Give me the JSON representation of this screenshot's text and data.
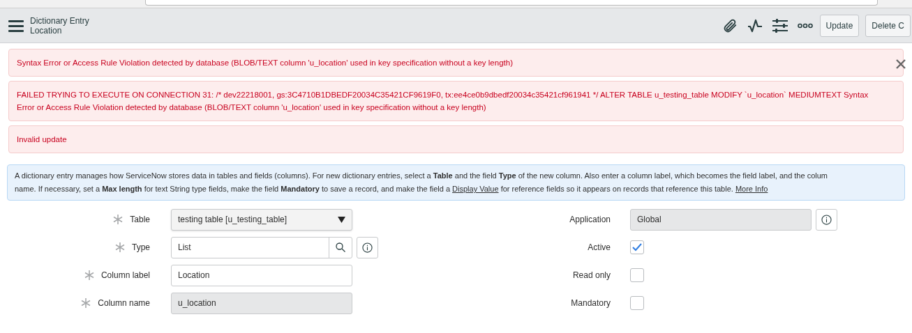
{
  "header": {
    "title": "Dictionary Entry",
    "subtitle": "Location",
    "buttons": [
      {
        "label": "Update"
      },
      {
        "label": "Delete C"
      }
    ]
  },
  "messages": [
    {
      "text": "Syntax Error or Access Rule Violation detected by database (BLOB/TEXT column 'u_location' used in key specification without a key length)",
      "closable": true
    },
    {
      "text": "FAILED TRYING TO EXECUTE ON CONNECTION 31: /* dev22218001, gs:3C4710B1DBEDF20034C35421CF9619F0, tx:ee4ce0b9dbedf20034c35421cf961941 */ ALTER TABLE u_testing_table MODIFY `u_location` MEDIUMTEXT Syntax Error or Access Rule Violation detected by database (BLOB/TEXT column 'u_location' used in key specification without a key length)",
      "closable": false
    },
    {
      "text": "Invalid update",
      "closable": false
    }
  ],
  "info": {
    "lines": [
      [
        {
          "kind": "text",
          "text": "A dictionary entry manages how ServiceNow stores data in tables and fields (columns). For new dictionary entries, select a **Table** and the field **Type** of the new column. Also enter a column label, which becomes the field label, and the colum"
        }
      ],
      [
        {
          "kind": "text",
          "text": "name. If necessary, set a **Max length** for text String type fields, make the field **Mandatory** to save a record, and make the field a"
        },
        {
          "kind": "link",
          "text": "Display Value"
        },
        {
          "kind": "text",
          "text": "for reference fields so it appears on records that reference this table."
        },
        {
          "kind": "link",
          "text": "More Info"
        }
      ]
    ]
  },
  "left_fields": [
    {
      "label": "Table",
      "required": true,
      "kind": "select",
      "value": "testing table [u_testing_table]"
    },
    {
      "label": "Type",
      "required": true,
      "kind": "reference",
      "value": "List"
    },
    {
      "label": "Column label",
      "required": true,
      "kind": "text",
      "value": "Location"
    },
    {
      "label": "Column name",
      "required": true,
      "kind": "readonly",
      "value": "u_location"
    }
  ],
  "right_fields": [
    {
      "label": "Application",
      "kind": "readonly_info",
      "value": "Global"
    },
    {
      "label": "Active",
      "kind": "checkbox",
      "checked": true
    },
    {
      "label": "Read only",
      "kind": "checkbox",
      "checked": false
    },
    {
      "label": "Mandatory",
      "kind": "checkbox",
      "checked": false
    }
  ]
}
